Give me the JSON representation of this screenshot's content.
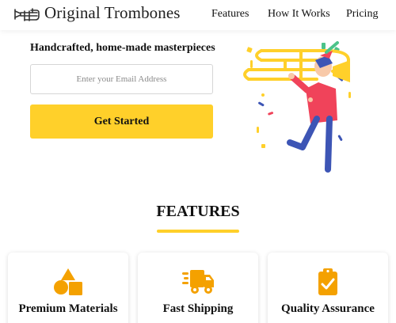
{
  "brand": {
    "name": "Original Trombones"
  },
  "nav": {
    "links": [
      {
        "label": "Features"
      },
      {
        "label": "How It Works"
      },
      {
        "label": "Pricing"
      }
    ]
  },
  "hero": {
    "title": "Handcrafted, home-made masterpieces",
    "email_placeholder": "Enter your Email Address",
    "email_value": "",
    "cta_label": "Get Started"
  },
  "features": {
    "title": "FEATURES",
    "cards": [
      {
        "title": "Premium Materials",
        "icon": "shapes-icon"
      },
      {
        "title": "Fast Shipping",
        "icon": "shipping-truck-icon"
      },
      {
        "title": "Quality Assurance",
        "icon": "clipboard-check-icon"
      }
    ]
  },
  "colors": {
    "accent": "#FFD02A",
    "icon_accent": "#F4A100",
    "figure_shirt": "#F0435A",
    "figure_pants": "#3D55B5",
    "figure_hat": "#F0435A"
  }
}
